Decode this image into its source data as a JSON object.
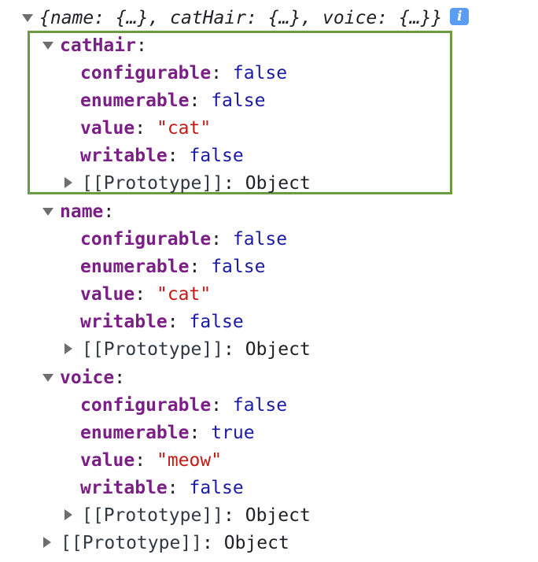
{
  "root": {
    "summary": "{name: {…}, catHair: {…}, voice: {…}}",
    "info_icon_glyph": "i"
  },
  "properties": [
    {
      "name": "catHair",
      "configurable": "false",
      "enumerable": "false",
      "value": "\"cat\"",
      "writable": "false",
      "prototype_label": "[[Prototype]]",
      "prototype_value": "Object",
      "highlighted": true
    },
    {
      "name": "name",
      "configurable": "false",
      "enumerable": "false",
      "value": "\"cat\"",
      "writable": "false",
      "prototype_label": "[[Prototype]]",
      "prototype_value": "Object",
      "highlighted": false
    },
    {
      "name": "voice",
      "configurable": "false",
      "enumerable": "true",
      "value": "\"meow\"",
      "writable": "false",
      "prototype_label": "[[Prototype]]",
      "prototype_value": "Object",
      "highlighted": false
    }
  ],
  "labels": {
    "configurable": "configurable",
    "enumerable": "enumerable",
    "value": "value",
    "writable": "writable",
    "colon": ":"
  },
  "root_prototype": {
    "label": "[[Prototype]]",
    "value": "Object"
  },
  "colors": {
    "key": "#7b1f86",
    "boolean": "#1a1aa6",
    "string": "#c41a16",
    "highlight_border": "#6a9a42",
    "info_badge": "#5b9cf5"
  },
  "icons": {
    "expanded": "triangle-down-icon",
    "collapsed": "triangle-right-icon",
    "info": "info-icon"
  }
}
